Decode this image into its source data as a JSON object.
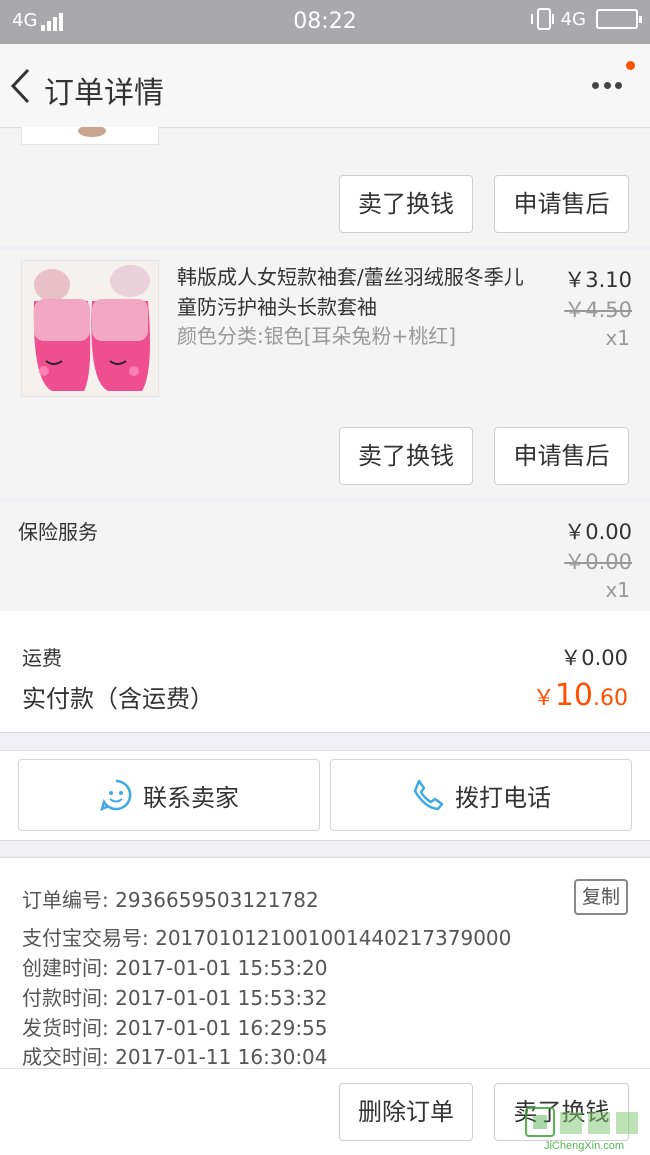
{
  "status_bar": {
    "network_left": "4G",
    "time": "08:22",
    "network_right": "4G"
  },
  "nav": {
    "title": "订单详情"
  },
  "product_1": {
    "btn_resell": "卖了换钱",
    "btn_after_sale": "申请售后"
  },
  "product_2": {
    "name": "韩版成人女短款袖套/蕾丝羽绒服冬季儿童防污护袖头长款套袖",
    "sku": "颜色分类:银色[耳朵兔粉+桃红]",
    "price": "￥3.10",
    "original_price": "￥4.50",
    "quantity": "x1",
    "btn_resell": "卖了换钱",
    "btn_after_sale": "申请售后"
  },
  "insurance": {
    "label": "保险服务",
    "price": "￥0.00",
    "original_price": "￥0.00",
    "quantity": "x1"
  },
  "summary": {
    "shipping_label": "运费",
    "shipping_value": "￥0.00",
    "paid_label": "实付款（含运费）",
    "paid_currency": "￥",
    "paid_int": "10",
    "paid_dec": ".60"
  },
  "contact": {
    "seller_label": "联系卖家",
    "phone_label": "拨打电话"
  },
  "order_info": {
    "order_no": "订单编号: 2936659503121782",
    "copy_label": "复制",
    "alipay_no": "支付宝交易号: 2017010121001001440217379000",
    "created": "创建时间: 2017-01-01 15:53:20",
    "paid": "付款时间: 2017-01-01 15:53:32",
    "shipped": "发货时间: 2017-01-01 16:29:55",
    "completed": "成交时间: 2017-01-11 16:30:04"
  },
  "bottom": {
    "delete_label": "删除订单",
    "resell_label": "卖了换钱"
  },
  "watermark": {
    "text": "JiChengXin.com"
  },
  "colors": {
    "accent": "#ff5000",
    "status_bar": "#a9a9ab",
    "contact_icon": "#3fa9e6"
  }
}
